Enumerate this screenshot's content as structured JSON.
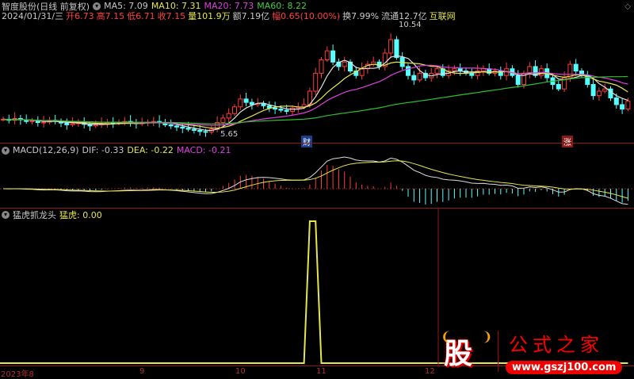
{
  "header": {
    "stock": "智度股份(日线 前复权)",
    "ma5": "MA5: 7.09",
    "ma10": "MA10: 7.31",
    "ma20": "MA20: 7.73",
    "ma60": "MA60: 8.22",
    "date": "2024/01/31/三",
    "open": "开6.73",
    "high": "高7.15",
    "low": "低6.71",
    "close": "收7.15",
    "volume": "量101.9万",
    "amount": "额7.19亿",
    "change": "幅0.65(10.00%)",
    "turnover": "换7.99%",
    "float": "流通12.7亿",
    "sector": "互联网"
  },
  "markers": {
    "high": "10.54",
    "low": "5.65",
    "finance": "财",
    "rise": "涨"
  },
  "macd": {
    "title": "MACD(12,26,9)",
    "dif": "DIF: -0.33",
    "dea": "DEA: -0.22",
    "macd": "MACD: -0.21"
  },
  "tiger": {
    "title": "猛虎抓龙头",
    "value": "猛虎: 0.00"
  },
  "axis": {
    "labels": [
      "2023年8",
      "9",
      "10",
      "11",
      "12"
    ]
  },
  "logo": {
    "char": "股",
    "name": "公式之家",
    "url": "www.gszj100.com"
  },
  "colors": {
    "up": "#ff3b3b",
    "down": "#54ffff",
    "ma5": "#e0e0e0",
    "ma10": "#e6e64a",
    "ma20": "#e040e0",
    "ma60": "#2fbf2f"
  },
  "chart_data": {
    "type": "candlestick",
    "ylim": [
      5.3,
      10.82
    ],
    "closes": [
      6.35,
      6.3,
      6.38,
      6.32,
      6.25,
      6.28,
      6.2,
      6.22,
      6.3,
      6.26,
      6.18,
      6.1,
      6.15,
      6.2,
      6.12,
      6.05,
      6.1,
      6.15,
      6.2,
      6.18,
      6.22,
      6.25,
      6.2,
      6.15,
      6.18,
      6.22,
      6.25,
      6.2,
      6.1,
      6.05,
      6.0,
      5.95,
      5.9,
      5.85,
      5.8,
      5.78,
      5.9,
      6.2,
      6.4,
      6.6,
      6.9,
      7.25,
      7.1,
      7.0,
      7.05,
      6.95,
      6.85,
      6.8,
      6.75,
      6.7,
      6.85,
      6.9,
      7.0,
      7.6,
      8.4,
      9.0,
      9.4,
      8.9,
      8.7,
      8.9,
      8.5,
      8.3,
      8.6,
      8.8,
      8.9,
      8.7,
      9.3,
      9.9,
      9.1,
      8.7,
      8.3,
      8.1,
      8.4,
      8.2,
      8.4,
      8.6,
      8.3,
      8.5,
      8.6,
      8.5,
      8.4,
      8.3,
      8.5,
      8.6,
      8.4,
      8.5,
      8.3,
      8.6,
      8.3,
      7.9,
      8.4,
      8.7,
      8.3,
      8.6,
      8.2,
      7.9,
      7.7,
      8.2,
      8.8,
      8.5,
      8.3,
      7.9,
      7.4,
      7.6,
      7.7,
      7.3,
      7.0,
      6.8,
      7.15
    ],
    "tiger_spikes": [
      53,
      54
    ]
  }
}
